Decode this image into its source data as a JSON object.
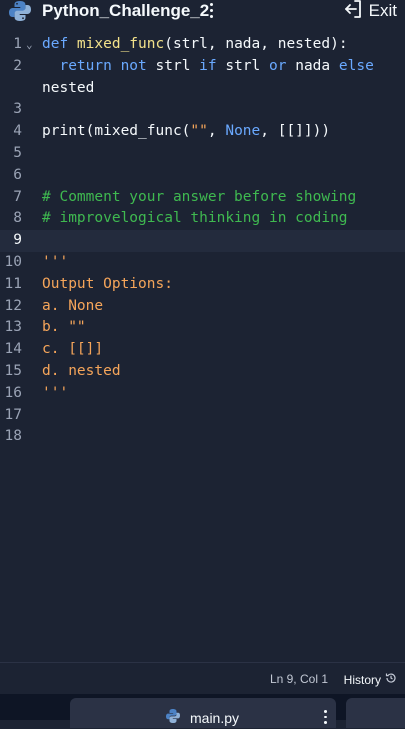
{
  "header": {
    "title": "Python_Challenge_2",
    "exit_label": "Exit"
  },
  "editor": {
    "lines": [
      {
        "n": "1",
        "tokens": [
          [
            "kw",
            "def "
          ],
          [
            "fn",
            "mixed_func"
          ],
          [
            "",
            "(strl, nada, nested):"
          ]
        ]
      },
      {
        "n": "2",
        "tokens": [
          [
            "",
            "  "
          ],
          [
            "kw",
            "return not "
          ],
          [
            "",
            "strl "
          ],
          [
            "kw",
            "if "
          ],
          [
            "",
            "strl "
          ],
          [
            "kw",
            "or "
          ],
          [
            "",
            "nada "
          ],
          [
            "kw",
            "else"
          ]
        ]
      },
      {
        "n": "",
        "tokens": [
          [
            "",
            "nested"
          ]
        ]
      },
      {
        "n": "3",
        "tokens": []
      },
      {
        "n": "4",
        "tokens": [
          [
            "",
            "print(mixed_func("
          ],
          [
            "str",
            "\"\""
          ],
          [
            "",
            ", "
          ],
          [
            "const",
            "None"
          ],
          [
            "",
            ", [[]]))"
          ]
        ]
      },
      {
        "n": "5",
        "tokens": []
      },
      {
        "n": "6",
        "tokens": []
      },
      {
        "n": "7",
        "tokens": [
          [
            "cm",
            "# Comment your answer before showing"
          ]
        ]
      },
      {
        "n": "8",
        "tokens": [
          [
            "cm",
            "# improvelogical thinking in coding"
          ]
        ]
      },
      {
        "n": "9",
        "tokens": []
      },
      {
        "n": "10",
        "tokens": [
          [
            "str",
            "'''"
          ]
        ]
      },
      {
        "n": "11",
        "tokens": [
          [
            "str",
            "Output Options:"
          ]
        ]
      },
      {
        "n": "12",
        "tokens": [
          [
            "str",
            "a. None"
          ]
        ]
      },
      {
        "n": "13",
        "tokens": [
          [
            "str",
            "b. \"\""
          ]
        ]
      },
      {
        "n": "14",
        "tokens": [
          [
            "str",
            "c. [[]]"
          ]
        ]
      },
      {
        "n": "15",
        "tokens": [
          [
            "str",
            "d. nested"
          ]
        ]
      },
      {
        "n": "16",
        "tokens": [
          [
            "str",
            "'''"
          ]
        ]
      },
      {
        "n": "17",
        "tokens": []
      },
      {
        "n": "18",
        "tokens": []
      }
    ]
  },
  "status": {
    "cursor": "Ln 9, Col 1",
    "history_label": "History"
  },
  "bottom_tabs": {
    "main_label": "main.py"
  },
  "colors": {
    "background": "#1c2333",
    "keyword": "#6aa9ff",
    "function": "#f2e18a",
    "string": "#f5a55a",
    "comment": "#3fb950"
  }
}
